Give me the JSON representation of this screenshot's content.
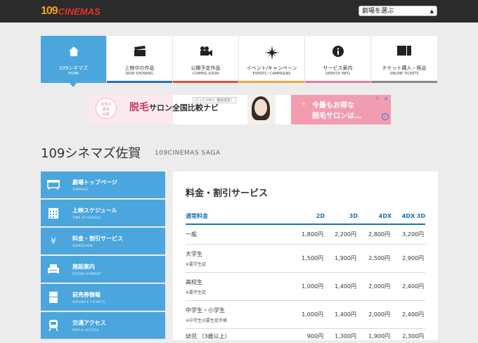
{
  "header": {
    "logo_num": "109",
    "logo_text": "CINEMAS",
    "theater_select": "劇場を選ぶ"
  },
  "nav": [
    {
      "ja": "109シネマズ",
      "en": "HOME",
      "icon": "home-icon"
    },
    {
      "ja": "上映中の作品",
      "en": "NOW SHOWING",
      "icon": "clapper-icon",
      "accent": "#2a6fb5"
    },
    {
      "ja": "公開予定作品",
      "en": "COMING SOON",
      "icon": "camera-icon",
      "accent": "#e84c3d"
    },
    {
      "ja": "イベント/キャンペーン",
      "en": "EVENTS / CAMPAIGNS",
      "icon": "sparkle-icon",
      "accent": "#f2a33a"
    },
    {
      "ja": "サービス案内",
      "en": "SERVICE INFO",
      "icon": "info-icon",
      "accent": "#e87a9b"
    },
    {
      "ja": "チケット購入・照会",
      "en": "ONLINE TICKETS",
      "icon": "ticket-icon",
      "accent": "#888888"
    }
  ],
  "ad": {
    "badge": "女性の\nための\n脱毛\n比較",
    "main_a": "脱",
    "main_b": "毛",
    "main_rest": "サロン全国比較ナビ",
    "tag": "ロコミ100人 徹底調査！",
    "right_1": "今最もお得な",
    "right_2": "脱毛サロンは…"
  },
  "title": {
    "ja": "109シネマズ佐賀",
    "en": "109CINEMAS SAGA"
  },
  "sidebar": [
    {
      "ja": "劇場トップページ",
      "en": "TOPPAGE",
      "icon": "theater-icon"
    },
    {
      "ja": "上映スケジュール",
      "en": "TIME SCHEDULE",
      "icon": "calendar-icon"
    },
    {
      "ja": "料金・割引サービス",
      "en": "ADMISSION",
      "icon": "yen-icon"
    },
    {
      "ja": "施設案内",
      "en": "ESTABLISHMENT",
      "icon": "seat-icon"
    },
    {
      "ja": "前売券情報",
      "en": "ADVANCE TICKETS",
      "icon": "ticket-icon"
    },
    {
      "ja": "交通アクセス",
      "en": "MAP & ACCESS",
      "icon": "train-icon"
    }
  ],
  "content": {
    "title": "料金・割引サービス",
    "headers": [
      "通常料金",
      "2D",
      "3D",
      "4DX",
      "4DX 3D"
    ],
    "rows": [
      {
        "cat": "一般",
        "note": "",
        "vals": [
          "1,800円",
          "2,200円",
          "2,800円",
          "3,200円"
        ]
      },
      {
        "cat": "大学生",
        "note": "※要学生証",
        "vals": [
          "1,500円",
          "1,900円",
          "2,500円",
          "2,900円"
        ]
      },
      {
        "cat": "高校生",
        "note": "※要学生証",
        "vals": [
          "1,000円",
          "1,400円",
          "2,000円",
          "2,400円"
        ]
      },
      {
        "cat": "中学生・小学生",
        "note": "※中学生は要生徒手帳",
        "vals": [
          "1,000円",
          "1,400円",
          "2,000円",
          "2,400円"
        ]
      },
      {
        "cat": "幼児 （3歳以上）",
        "note": "",
        "vals": [
          "900円",
          "1,300円",
          "1,900円",
          "2,300円"
        ]
      }
    ]
  }
}
